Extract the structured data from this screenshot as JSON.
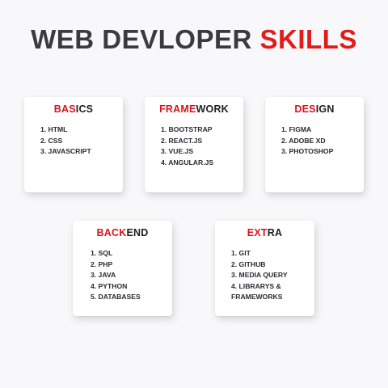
{
  "header": {
    "title_main": "WEB DEVLOPER",
    "title_accent": "SKILLS"
  },
  "colors": {
    "accent": "#e21b1b",
    "title_dark": "#3b3b3f",
    "text": "#2a2a2e",
    "card_bg": "#ffffff",
    "page_bg": "#f8f8fa"
  },
  "cards": [
    {
      "title_highlight": "BAS",
      "title_rest": "ICS",
      "items": [
        "1. HTML",
        "2. CSS",
        "3. JAVASCRIPT"
      ]
    },
    {
      "title_highlight": "FRAME",
      "title_rest": "WORK",
      "items": [
        "1. BOOTSTRAP",
        "2. REACT.JS",
        "3. VUE.JS",
        "4. ANGULAR.JS"
      ]
    },
    {
      "title_highlight": "DES",
      "title_rest": "IGN",
      "items": [
        "1. FIGMA",
        "2. ADOBE XD",
        "3. PHOTOSHOP"
      ]
    },
    {
      "title_highlight": "BACK",
      "title_rest": "END",
      "items": [
        "1. SQL",
        "2. PHP",
        "3. JAVA",
        "4. PYTHON",
        "5. DATABASES"
      ]
    },
    {
      "title_highlight": "EXT",
      "title_rest": "RA",
      "items": [
        "1. GIT",
        "2. GITHUB",
        "3. MEDIA QUERY",
        "4. LIBRARYS & FRAMEWORKS"
      ]
    }
  ]
}
